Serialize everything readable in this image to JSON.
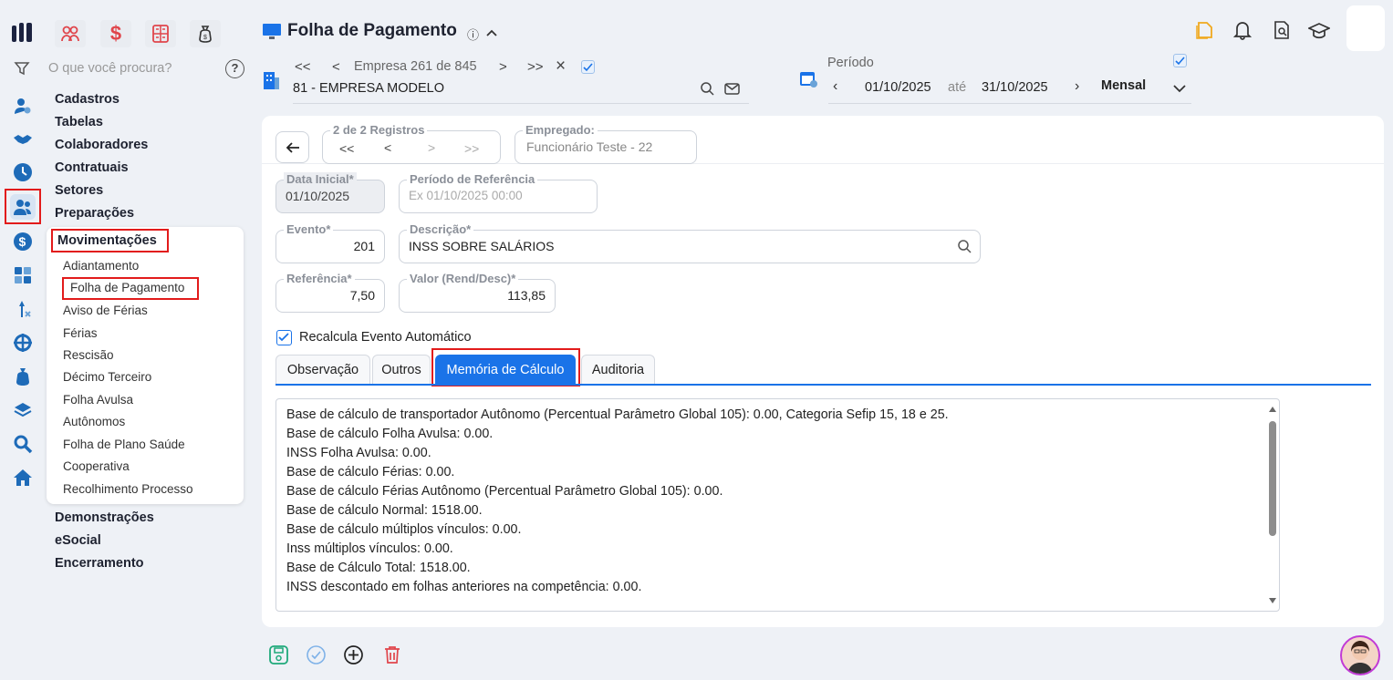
{
  "header": {
    "title": "Folha de Pagamento",
    "title_info": "ⓘ"
  },
  "search": {
    "placeholder": "O que você procura?",
    "help": "?"
  },
  "company_nav": {
    "first": "<<",
    "prev": "<",
    "counter": "Empresa 261 de 845",
    "next": ">",
    "last": ">>",
    "close": "×",
    "company_name": "81 - EMPRESA MODELO"
  },
  "period": {
    "label": "Período",
    "start": "01/10/2025",
    "separator": "até",
    "end": "31/10/2025",
    "mode": "Mensal"
  },
  "menu": {
    "sections_top": [
      "Cadastros",
      "Tabelas",
      "Colaboradores",
      "Contratuais",
      "Setores",
      "Preparações"
    ],
    "active_section": "Movimentações",
    "sub_items": [
      "Adiantamento",
      "Folha de Pagamento",
      "Aviso de Férias",
      "Férias",
      "Rescisão",
      "Décimo Terceiro",
      "Folha Avulsa",
      "Autônomos",
      "Folha de Plano Saúde",
      "Cooperativa",
      "Recolhimento Processo"
    ],
    "sections_bottom": [
      "Demonstrações",
      "eSocial",
      "Encerramento"
    ]
  },
  "form": {
    "registros": {
      "label": "2 de 2 Registros",
      "first": "<<",
      "prev": "<",
      "next": ">",
      "last": ">>"
    },
    "empregado": {
      "label": "Empregado:",
      "value": "Funcionário Teste - 22"
    },
    "data_inicial": {
      "label": "Data Inicial*",
      "value": "01/10/2025"
    },
    "periodo_ref": {
      "label": "Período de Referência",
      "placeholder": "Ex 01/10/2025 00:00"
    },
    "evento": {
      "label": "Evento*",
      "value": "201"
    },
    "descricao": {
      "label": "Descrição*",
      "value": "INSS SOBRE SALÁRIOS"
    },
    "referencia": {
      "label": "Referência*",
      "value": "7,50"
    },
    "valor": {
      "label": "Valor (Rend/Desc)*",
      "value": "113,85"
    },
    "recalcula": {
      "label": "Recalcula Evento Automático",
      "checked": true
    }
  },
  "tabs": [
    "Observação",
    "Outros",
    "Memória de Cálculo",
    "Auditoria"
  ],
  "active_tab": "Memória de Cálculo",
  "memoria": [
    "Base de cálculo de transportador Autônomo (Percentual Parâmetro Global 105): 0.00, Categoria Sefip 15, 18 e 25.",
    "Base de cálculo Folha Avulsa: 0.00.",
    "INSS Folha Avulsa: 0.00.",
    "Base de cálculo Férias: 0.00.",
    "Base de cálculo Férias Autônomo (Percentual Parâmetro Global 105): 0.00.",
    "Base de cálculo Normal: 1518.00.",
    "Base de cálculo múltiplos vínculos: 0.00.",
    "Inss múltiplos vínculos: 0.00.",
    "Base de Cálculo Total: 1518.00.",
    "INSS descontado em folhas anteriores na competência: 0.00."
  ],
  "colors": {
    "accent": "#1a73e8",
    "highlight": "#e21b1b",
    "rail_blue": "#1e6bb8"
  }
}
